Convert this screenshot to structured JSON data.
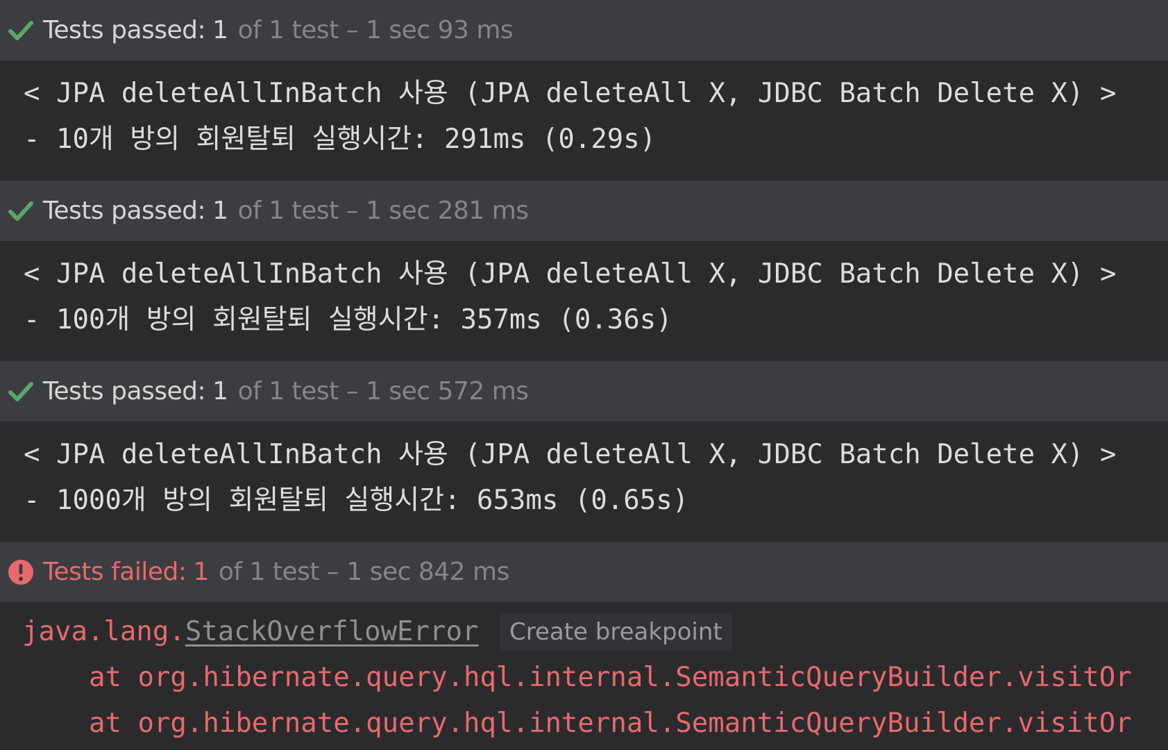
{
  "colors": {
    "background": "#2b2b2d",
    "status_bar": "#3b3d40",
    "pass_green": "#59a869",
    "fail_red": "#e8696b",
    "text": "#dcdcdc",
    "muted": "#848588"
  },
  "runs": [
    {
      "status": "passed",
      "icon": "check-icon",
      "label": "Tests passed:",
      "count": "1",
      "rest": "of 1 test – 1 sec 93 ms",
      "output": [
        "< JPA deleteAllInBatch 사용 (JPA deleteAll X, JDBC Batch Delete X) >",
        "- 10개 방의 회원탈퇴 실행시간: 291ms (0.29s)"
      ]
    },
    {
      "status": "passed",
      "icon": "check-icon",
      "label": "Tests passed:",
      "count": "1",
      "rest": "of 1 test – 1 sec 281 ms",
      "output": [
        "< JPA deleteAllInBatch 사용 (JPA deleteAll X, JDBC Batch Delete X) >",
        "- 100개 방의 회원탈퇴 실행시간: 357ms (0.36s)"
      ]
    },
    {
      "status": "passed",
      "icon": "check-icon",
      "label": "Tests passed:",
      "count": "1",
      "rest": "of 1 test – 1 sec 572 ms",
      "output": [
        "< JPA deleteAllInBatch 사용 (JPA deleteAll X, JDBC Batch Delete X) >",
        "- 1000개 방의 회원탈퇴 실행시간: 653ms (0.65s)"
      ]
    },
    {
      "status": "failed",
      "icon": "error-icon",
      "label": "Tests failed:",
      "count": "1",
      "rest": "of 1 test – 1 sec 842 ms"
    }
  ],
  "error": {
    "prefix": "java.lang.",
    "exception": "StackOverflowError",
    "breakpoint_label": "Create breakpoint",
    "stack": [
      "at org.hibernate.query.hql.internal.SemanticQueryBuilder.visitOr",
      "at org.hibernate.query.hql.internal.SemanticQueryBuilder.visitOr"
    ]
  }
}
